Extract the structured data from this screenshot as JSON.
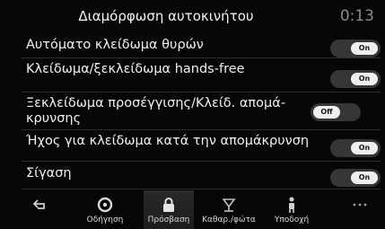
{
  "header": {
    "title": "Διαμόρφωση αυτοκινήτου",
    "clock": "0:13"
  },
  "settings": [
    {
      "label": "Αυτόματο κλείδωμα θυρών",
      "toggle": "On"
    },
    {
      "label": "Κλείδωμα/ξεκλείδωμα hands-free",
      "toggle": "On"
    },
    {
      "label_line1": "Ξεκλείδωμα προσέγγισης/Κλείδ. απομά-",
      "label_line2": "κρυνσης",
      "toggle": "Off"
    },
    {
      "label": "Ήχος για κλείδωμα κατά την απομάκρυνση",
      "toggle": "On"
    },
    {
      "label": "Σίγαση",
      "toggle": "On"
    }
  ],
  "navbar": {
    "items": [
      {
        "label": "",
        "icon": "back-arrow-icon"
      },
      {
        "label": "Οδήγηση",
        "icon": "driving-icon"
      },
      {
        "label": "Πρόσβαση",
        "icon": "lock-icon",
        "active": true
      },
      {
        "label": "Καθαρ./φώτα",
        "icon": "wiper-light-icon"
      },
      {
        "label": "Υποδοχή",
        "icon": "welcome-person-icon"
      },
      {
        "label": "",
        "icon": "more-dots-icon"
      }
    ]
  }
}
